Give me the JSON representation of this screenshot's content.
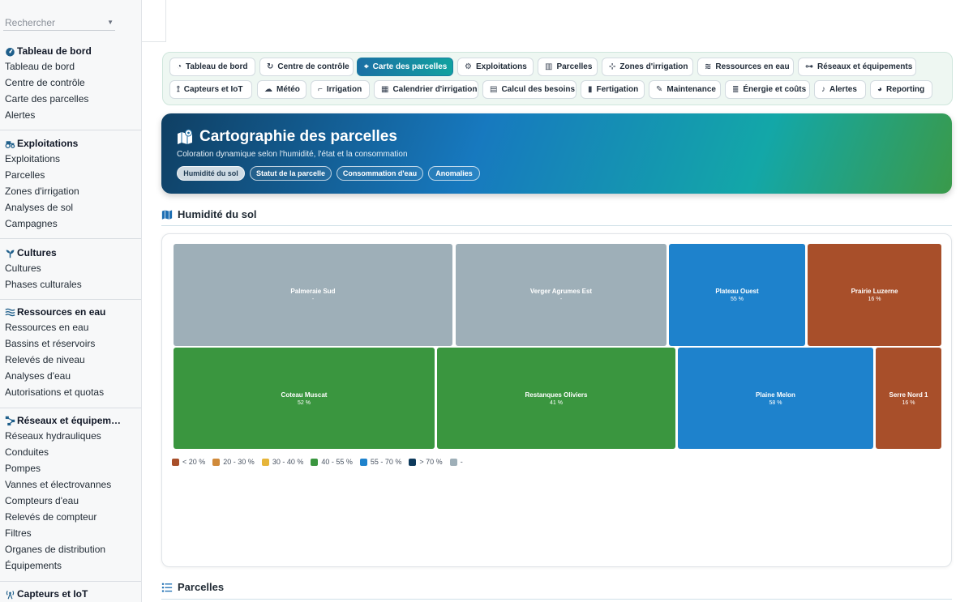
{
  "search": {
    "placeholder": "Rechercher"
  },
  "sidebar": {
    "sections": [
      {
        "title": "Tableau de bord",
        "items": [
          "Tableau de bord",
          "Centre de contrôle",
          "Carte des parcelles",
          "Alertes"
        ]
      },
      {
        "title": "Exploitations",
        "items": [
          "Exploitations",
          "Parcelles",
          "Zones d'irrigation",
          "Analyses de sol",
          "Campagnes"
        ]
      },
      {
        "title": "Cultures",
        "items": [
          "Cultures",
          "Phases culturales"
        ]
      },
      {
        "title": "Ressources en eau",
        "items": [
          "Ressources en eau",
          "Bassins et réservoirs",
          "Relevés de niveau",
          "Analyses d'eau",
          "Autorisations et quotas"
        ]
      },
      {
        "title": "Réseaux et équipem…",
        "items": [
          "Réseaux hydrauliques",
          "Conduites",
          "Pompes",
          "Vannes et électrovannes",
          "Compteurs d'eau",
          "Relevés de compteur",
          "Filtres",
          "Organes de distribution",
          "Équipements"
        ]
      },
      {
        "title": "Capteurs et IoT",
        "items": []
      }
    ]
  },
  "tabs": {
    "row1": [
      {
        "label": "Tableau de bord",
        "icon": "gauge-icon",
        "active": false
      },
      {
        "label": "Centre de contrôle",
        "icon": "sync-icon",
        "active": false
      },
      {
        "label": "Carte des parcelles",
        "icon": "map-icon",
        "active": true
      },
      {
        "label": "Exploitations",
        "icon": "tractor-icon",
        "active": false
      },
      {
        "label": "Parcelles",
        "icon": "map-fold-icon",
        "active": false
      },
      {
        "label": "Zones d'irrigation",
        "icon": "sitemap-icon",
        "active": false
      },
      {
        "label": "Ressources en eau",
        "icon": "water-icon",
        "active": false
      },
      {
        "label": "Réseaux et équipements",
        "icon": "network-icon",
        "active": false
      }
    ],
    "row2": [
      {
        "label": "Capteurs et IoT",
        "icon": "antenna-icon",
        "active": false
      },
      {
        "label": "Météo",
        "icon": "cloud-icon",
        "active": false
      },
      {
        "label": "Irrigation",
        "icon": "faucet-icon",
        "active": false
      },
      {
        "label": "Calendrier d'irrigation",
        "icon": "calendar-icon",
        "active": false
      },
      {
        "label": "Calcul des besoins",
        "icon": "calculator-icon",
        "active": false
      },
      {
        "label": "Fertigation",
        "icon": "flask-icon",
        "active": false
      },
      {
        "label": "Maintenance",
        "icon": "wrench-icon",
        "active": false
      },
      {
        "label": "Énergie et coûts",
        "icon": "coins-icon",
        "active": false
      },
      {
        "label": "Alertes",
        "icon": "bell-icon",
        "active": false
      },
      {
        "label": "Reporting",
        "icon": "chart-pie-icon",
        "active": false
      }
    ]
  },
  "hero": {
    "title": "Cartographie des parcelles",
    "subtitle": "Coloration dynamique selon l'humidité, l'état et la consommation",
    "pills": [
      {
        "label": "Humidité du sol",
        "active": true
      },
      {
        "label": "Statut de la parcelle",
        "active": false
      },
      {
        "label": "Consommation d'eau",
        "active": false
      },
      {
        "label": "Anomalies",
        "active": false
      }
    ]
  },
  "map_section": {
    "heading": "Humidité du sol"
  },
  "treemap": {
    "cells": [
      {
        "name": "Palmeraie Sud",
        "value": "-",
        "color": "#9eafb8"
      },
      {
        "name": "Verger Agrumes Est",
        "value": "-",
        "color": "#9eafb8"
      },
      {
        "name": "Plateau Ouest",
        "value": "55 %",
        "color": "#1e82cc"
      },
      {
        "name": "Prairie Luzerne",
        "value": "16 %",
        "color": "#a84f2a"
      },
      {
        "name": "Coteau Muscat",
        "value": "52 %",
        "color": "#3a963f"
      },
      {
        "name": "Restanques Oliviers",
        "value": "41 %",
        "color": "#3a963f"
      },
      {
        "name": "Plaine Melon",
        "value": "58 %",
        "color": "#1e82cc"
      },
      {
        "name": "Serre Nord 1",
        "value": "16 %",
        "color": "#a84f2a"
      }
    ]
  },
  "legend": [
    {
      "label": "< 20 %",
      "color": "#a84f2a"
    },
    {
      "label": "20 - 30 %",
      "color": "#d08a3a"
    },
    {
      "label": "30 - 40 %",
      "color": "#e6b53a"
    },
    {
      "label": "40 - 55 %",
      "color": "#3a963f"
    },
    {
      "label": "55 - 70 %",
      "color": "#1e82cc"
    },
    {
      "label": "> 70 %",
      "color": "#0d3a5c"
    },
    {
      "label": "-",
      "color": "#9eafb8"
    }
  ],
  "parcels_section": {
    "heading": "Parcelles"
  }
}
